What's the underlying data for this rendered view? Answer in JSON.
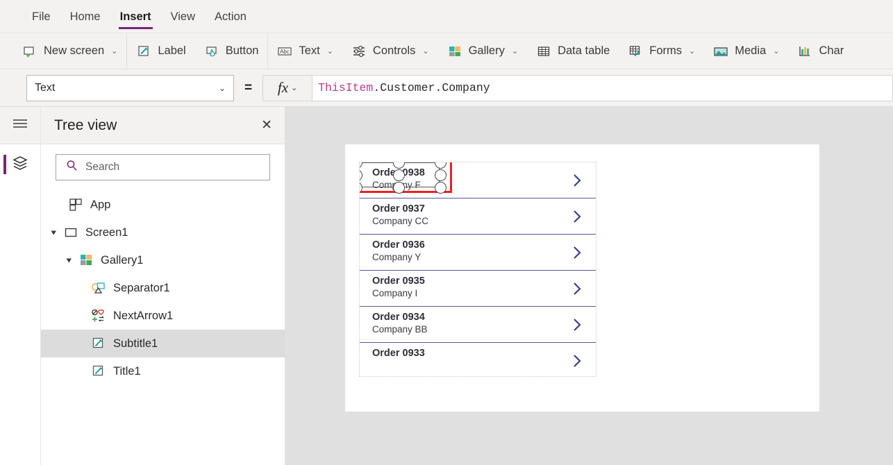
{
  "menubar": {
    "items": [
      {
        "label": "File",
        "active": false
      },
      {
        "label": "Home",
        "active": false
      },
      {
        "label": "Insert",
        "active": true
      },
      {
        "label": "View",
        "active": false
      },
      {
        "label": "Action",
        "active": false
      }
    ]
  },
  "ribbon": {
    "items": [
      {
        "label": "New screen",
        "icon": "new-screen-icon",
        "caret": "⌄"
      },
      {
        "label": "Label",
        "icon": "label-icon",
        "caret": ""
      },
      {
        "label": "Button",
        "icon": "button-icon",
        "caret": ""
      },
      {
        "label": "Text",
        "icon": "text-abc-icon",
        "caret": "⌄"
      },
      {
        "label": "Controls",
        "icon": "controls-sliders-icon",
        "caret": "⌄"
      },
      {
        "label": "Gallery",
        "icon": "gallery-grid-icon",
        "caret": "⌄"
      },
      {
        "label": "Data table",
        "icon": "data-table-icon",
        "caret": ""
      },
      {
        "label": "Forms",
        "icon": "forms-icon",
        "caret": "⌄"
      },
      {
        "label": "Media",
        "icon": "media-image-icon",
        "caret": "⌄"
      },
      {
        "label": "Char",
        "icon": "charts-bar-icon",
        "caret": ""
      }
    ]
  },
  "propertybar": {
    "selected_property": "Text",
    "dropdown_caret": "⌄",
    "equals": "=",
    "fx_label": "fx",
    "fx_caret": "⌄",
    "formula_identifier": "ThisItem",
    "formula_rest": ".Customer.Company"
  },
  "rail": {
    "hamburger": "hamburger-menu-icon",
    "layers": "layers-tree-icon"
  },
  "treeview": {
    "title": "Tree view",
    "close_label": "✕",
    "search_placeholder": "Search",
    "items": [
      {
        "label": "App",
        "icon": "app-icon",
        "indent": 0,
        "twisty": "none",
        "selected": false
      },
      {
        "label": "Screen1",
        "icon": "screen-icon",
        "indent": 0,
        "twisty": "expanded",
        "selected": false
      },
      {
        "label": "Gallery1",
        "icon": "gallery-icon",
        "indent": 1,
        "twisty": "expanded",
        "selected": false
      },
      {
        "label": "Separator1",
        "icon": "separator-icon",
        "indent": 2,
        "twisty": "none",
        "selected": false
      },
      {
        "label": "NextArrow1",
        "icon": "next-arrow-icon",
        "indent": 2,
        "twisty": "none",
        "selected": false
      },
      {
        "label": "Subtitle1",
        "icon": "label-edit-icon",
        "indent": 2,
        "twisty": "none",
        "selected": true
      },
      {
        "label": "Title1",
        "icon": "label-edit-icon",
        "indent": 2,
        "twisty": "none",
        "selected": false
      }
    ]
  },
  "canvas": {
    "gallery_rows": [
      {
        "title": "Order 0938",
        "subtitle": "Company F",
        "selected": true
      },
      {
        "title": "Order 0937",
        "subtitle": "Company CC",
        "selected": false
      },
      {
        "title": "Order 0936",
        "subtitle": "Company Y",
        "selected": false
      },
      {
        "title": "Order 0935",
        "subtitle": "Company I",
        "selected": false
      },
      {
        "title": "Order 0934",
        "subtitle": "Company BB",
        "selected": false
      },
      {
        "title": "Order 0933",
        "subtitle": "",
        "selected": false
      }
    ]
  },
  "colors": {
    "accent_purple": "#742774",
    "selection_red": "#ee2020",
    "chevron_blue": "#3b3f87",
    "canvas_bg": "#e0e0e0",
    "chrome_bg": "#f3f2f1",
    "tree_selected_bg": "#dcdcdc"
  }
}
